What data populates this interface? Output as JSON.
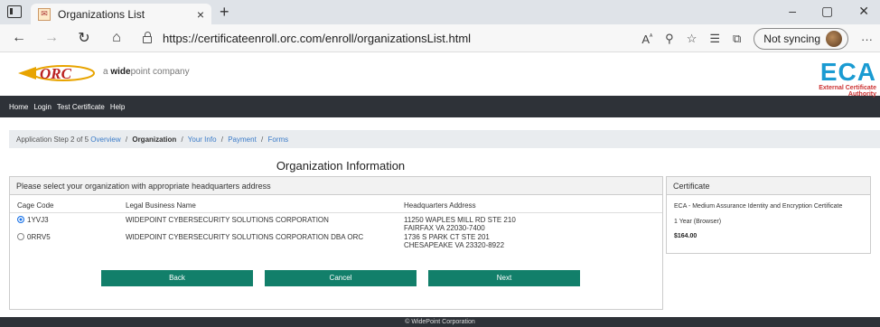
{
  "browser": {
    "tab_title": "Organizations List",
    "tab_close": "×",
    "new_tab": "+",
    "url": "https://certificateenroll.orc.com/enroll/organizationsList.html",
    "sync_label": "Not syncing",
    "win_min": "–",
    "win_max": "▢",
    "win_close": "✕",
    "more": "···"
  },
  "header": {
    "logo_text": "ORC",
    "tagline_prefix": "a ",
    "tagline_bold": "wide",
    "tagline_rest": "point company",
    "eca_big": "ECA",
    "eca_sub": "External Certificate Authority"
  },
  "nav": {
    "items": [
      "Home",
      "Login",
      "Test Certificate",
      "Help"
    ]
  },
  "breadcrumb": {
    "prefix": "Application Step 2 of 5",
    "steps": [
      "Overview",
      "Organization",
      "Your Info",
      "Payment",
      "Forms"
    ],
    "active_index": 1
  },
  "page_title": "Organization Information",
  "org_panel": {
    "heading": "Please select your organization with appropriate headquarters address",
    "columns": [
      "Cage Code",
      "Legal Business Name",
      "Headquarters Address"
    ],
    "rows": [
      {
        "selected": true,
        "cage": "1YVJ3",
        "name": "WIDEPOINT CYBERSECURITY SOLUTIONS CORPORATION",
        "addr1": "11250 WAPLES MILL RD STE 210",
        "addr2": "FAIRFAX VA  22030-7400"
      },
      {
        "selected": false,
        "cage": "0RRV5",
        "name": "WIDEPOINT CYBERSECURITY SOLUTIONS CORPORATION DBA ORC",
        "addr1": "1736 S PARK CT STE 201",
        "addr2": "CHESAPEAKE VA  23320-8922"
      }
    ],
    "buttons": {
      "back": "Back",
      "cancel": "Cancel",
      "next": "Next"
    }
  },
  "cert_panel": {
    "heading": "Certificate",
    "description": "ECA - Medium Assurance Identity and Encryption Certificate",
    "term": "1 Year (Browser)",
    "price": "$164.00"
  },
  "footer": {
    "text": "© WidePoint Corporation"
  },
  "colors": {
    "accent_button": "#127f6a",
    "nav_bg": "#2e3238",
    "link": "#3a7bc8",
    "eca_blue": "#1a9bd2"
  }
}
